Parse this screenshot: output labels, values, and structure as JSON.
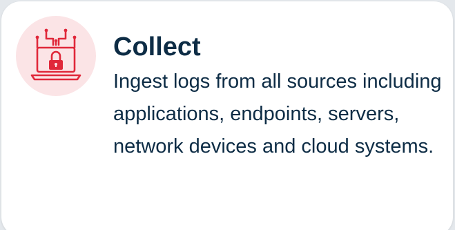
{
  "card": {
    "icon": "laptop-lock-icon",
    "title": "Collect",
    "description": "Ingest logs from all sources including applications, endpoints, servers, network devices and cloud systems."
  },
  "colors": {
    "accent": "#e0283a",
    "icon_bg": "#fbe4e6",
    "text": "#0d2c45",
    "card_bg": "#ffffff",
    "page_bg": "#e4e8ec"
  }
}
